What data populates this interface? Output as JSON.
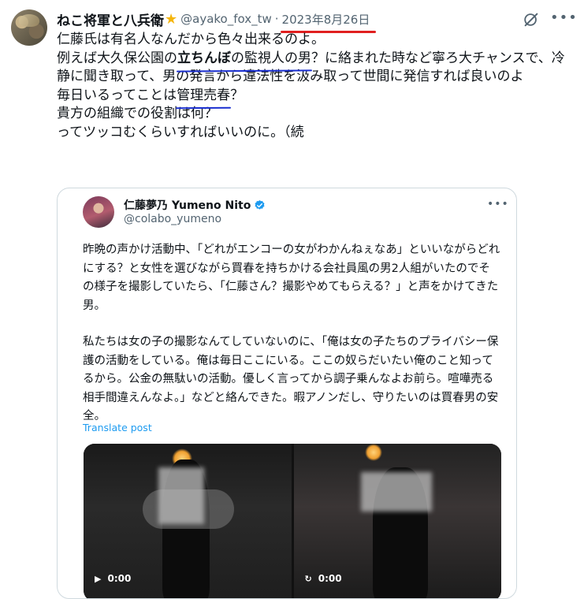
{
  "author": {
    "display_name": "ねこ将軍と八兵衛",
    "badge_icon": "star-icon",
    "handle": "@ayako_fox_tw",
    "separator": "·",
    "date": "2023年8月26日"
  },
  "actions": {
    "grok_icon": "grok-icon",
    "more_label": "•••"
  },
  "tweet": {
    "line1": "仁藤氏は有名人なんだから色々出来るのよ。",
    "line2_pre": "例えば大久保公園の",
    "line2_hl_bold": "立ちんぼ",
    "line2_hl_rest": "の監視人の男",
    "line2_post": "？に絡まれた時など寧ろ大チャンスで、冷静に聞き取って、男の発言から違法性を汲み取って世間に発信すれば良いのよ",
    "line3_pre": "毎日いるってことは",
    "line3_hl": "管理売春",
    "line3_post": "？",
    "line4": "貴方の組織での役割は何？",
    "line5": "ってツッコむくらいすればいいのに。（続"
  },
  "quote": {
    "name": "仁藤夢乃 Yumeno Nito",
    "verified_icon": "verified-badge-icon",
    "handle": "@colabo_yumeno",
    "more_label": "•••",
    "paragraph1": "昨晩の声かけ活動中、「どれがエンコーの女がわかんねぇなあ」といいながらどれにする？と女性を選びながら買春を持ちかける会社員風の男2人組がいたのでその様子を撮影していたら、「仁藤さん？撮影やめてもらえる？」と声をかけてきた男。",
    "paragraph2": "私たちは女の子の撮影なんてしていないのに、「俺は女の子たちのプライバシー保護の活動をしている。俺は毎日ここにいる。ここの奴らだいたい俺のこと知ってるから。公金の無駄いの活動。優しく言ってから調子乗んなよお前ら。喧嘩売る相手間違えんなよ。」などと絡んできた。暇アノンだし、守りたいのは買春男の安全。",
    "translate_label": "Translate post",
    "videos": [
      {
        "control_icon": "play-icon",
        "time": "0:00"
      },
      {
        "control_icon": "replay-icon",
        "time": "0:00"
      }
    ]
  },
  "colors": {
    "date_underline": "#e02020",
    "annotation_underline": "#1a2fd0",
    "link": "#1d9bf0"
  }
}
